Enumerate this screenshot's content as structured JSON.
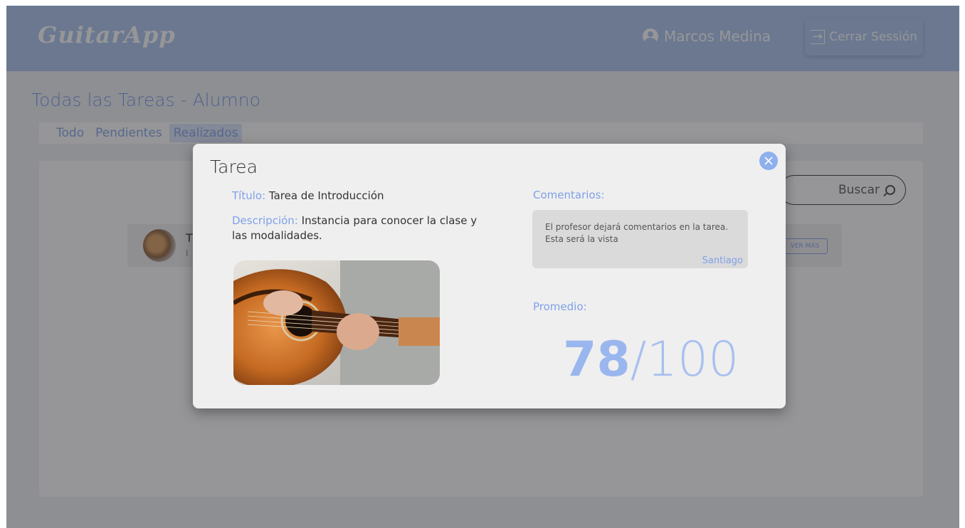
{
  "header": {
    "logo": "GuitarApp",
    "user_name": "Marcos Medina",
    "logout_label": "Cerrar Sessión"
  },
  "page": {
    "title": "Todas las Tareas - Alumno",
    "tabs": [
      {
        "label": "Todo"
      },
      {
        "label": "Pendientes"
      },
      {
        "label": "Realizados",
        "active": true
      }
    ],
    "search_label": "Buscar",
    "task": {
      "title": "T",
      "subtitle": "I",
      "see_more": "VER MÁS"
    }
  },
  "modal": {
    "title": "Tarea",
    "titulo_label": "Título:",
    "titulo_value": "Tarea de Introducción",
    "descripcion_label": "Descripción:",
    "descripcion_value": "Instancia para conocer la clase y las modalidades.",
    "comentarios_label": "Comentarios:",
    "comment_text": "El profesor dejará comentarios en la tarea. Esta será la vista",
    "comment_author": "Santiago",
    "promedio_label": "Promedio:",
    "score": "78",
    "score_separator": "/",
    "score_max": "100"
  },
  "colors": {
    "accent": "#7fa0e8",
    "header": "#a9c3ee",
    "score": "#9ab6ee"
  }
}
